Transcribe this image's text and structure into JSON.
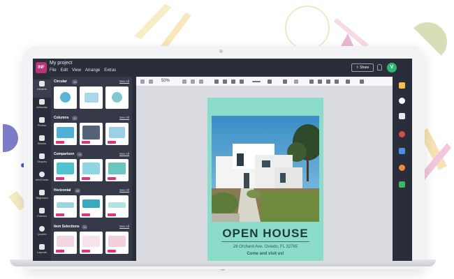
{
  "app": {
    "logo_text": "INF",
    "project_title": "My project",
    "menu": [
      "File",
      "Edit",
      "View",
      "Arrange",
      "Extras"
    ],
    "share_label": "Share",
    "avatar_initial": "V",
    "accent": "#2bb673",
    "brand": "#b9327a"
  },
  "toolbar": {
    "zoom": "50%"
  },
  "rail": {
    "items": [
      {
        "label": "InfoArts",
        "icon": "grid-icon"
      },
      {
        "label": "Artworks",
        "icon": "artwork-icon"
      },
      {
        "label": "Photos",
        "icon": "camera-icon"
      },
      {
        "label": "Blocks",
        "icon": "blocks-icon"
      },
      {
        "label": "Shapes",
        "icon": "shapes-icon"
      },
      {
        "label": "InfoCharts",
        "icon": "chart-icon"
      },
      {
        "label": "Bkground",
        "icon": "background-icon"
      },
      {
        "label": "Frames",
        "icon": "frame-icon"
      },
      {
        "label": "Quotes",
        "icon": "quote-icon"
      },
      {
        "label": "Layouts",
        "icon": "layout-icon"
      }
    ]
  },
  "panel": {
    "see_all": "See All",
    "sections": [
      {
        "title": "Circular",
        "count": "19"
      },
      {
        "title": "Columns",
        "count": "30"
      },
      {
        "title": "Comparison",
        "count": "15"
      },
      {
        "title": "Horizontal",
        "count": "48"
      },
      {
        "title": "Item Selections",
        "count": "13"
      }
    ]
  },
  "flyer": {
    "title": "OPEN HOUSE",
    "address": "28 Orchard Ave. Oviedo, FL 32765",
    "cta": "Come and visit us!",
    "background": "#8cdccb"
  }
}
